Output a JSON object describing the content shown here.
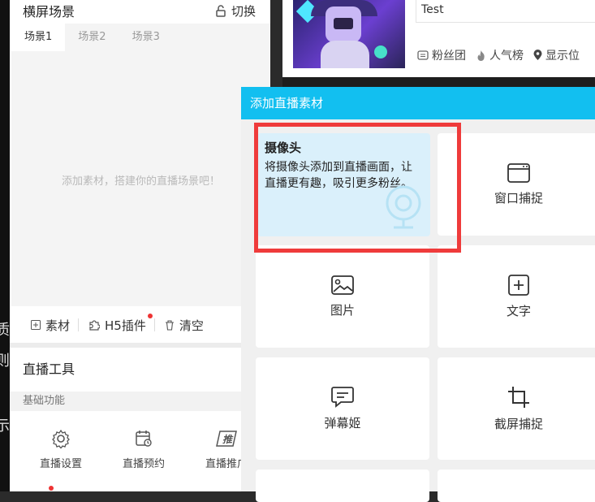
{
  "scene": {
    "title": "横屏场景",
    "switch_label": "切换",
    "tabs": [
      "场景1",
      "场景2",
      "场景3"
    ],
    "empty_hint": "添加素材，搭建你的直播场景吧！"
  },
  "asset_bar": {
    "material": "素材",
    "h5_plugin": "H5插件",
    "clear": "清空"
  },
  "tools": {
    "title": "直播工具",
    "basic_label": "基础功能",
    "items": [
      "直播设置",
      "直播预约",
      "直播推广"
    ]
  },
  "stream_info": {
    "title_value": "Test",
    "fan_group": "粉丝团",
    "popularity": "人气榜",
    "show_location": "显示位"
  },
  "modal": {
    "title": "添加直播素材",
    "camera_title": "摄像头",
    "camera_desc": "将摄像头添加到直播画面，让直播更有趣，吸引更多粉丝。",
    "window_capture": "窗口捕捉",
    "image": "图片",
    "text": "文字",
    "danmaku": "弹幕姬",
    "screen_capture": "截屏捕捉"
  },
  "colors": {
    "modal_header": "#12bff0",
    "highlight": "#ef3b3b",
    "camera_card_bg": "#daf0fb"
  }
}
